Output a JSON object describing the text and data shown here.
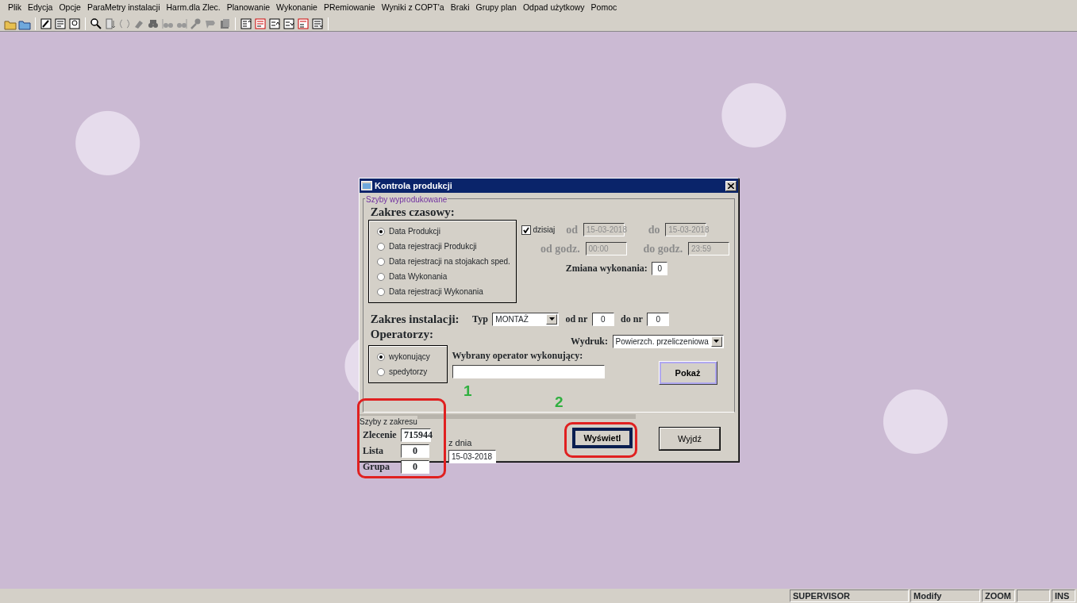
{
  "menu": [
    "Plik",
    "Edycja",
    "Opcje",
    "ParaMetry instalacji",
    "Harm.dla Zlec.",
    "Planowanie",
    "Wykonanie",
    "PRemiowanie",
    "Wyniki z COPT'a",
    "Braki",
    "Grupy plan",
    "Odpad użytkowy",
    "Pomoc"
  ],
  "dialog": {
    "title": "Kontrola produkcji",
    "group_label": "Szyby wyprodukowane",
    "time_range": {
      "heading": "Zakres czasowy:",
      "options": [
        {
          "label": "Data Produkcji",
          "selected": true
        },
        {
          "label": "Data rejestracji Produkcji",
          "selected": false
        },
        {
          "label": "Data rejestracji na stojakach sped.",
          "selected": false
        },
        {
          "label": "Data Wykonania",
          "selected": false
        },
        {
          "label": "Data rejestracji Wykonania",
          "selected": false
        }
      ]
    },
    "today": {
      "label": "dzisiaj",
      "checked": true
    },
    "dates": [
      {
        "label": "od",
        "value": "15-03-2018",
        "disabled": true
      },
      {
        "label": "do",
        "value": "15-03-2018",
        "disabled": true
      }
    ],
    "times": [
      {
        "label": "od godz.",
        "value": "00:00",
        "disabled": true
      },
      {
        "label": "do godz.",
        "value": "23:59",
        "disabled": true
      }
    ],
    "shift": {
      "label": "Zmiana wykonania:",
      "value": "0"
    },
    "installation": {
      "heading": "Zakres instalacji:",
      "type_label": "Typ",
      "type_value": "MONTAŻ",
      "from_label": "od nr",
      "from_value": "0",
      "to_label": "do nr",
      "to_value": "0"
    },
    "operators": {
      "heading": "Operatorzy:",
      "options": [
        {
          "label": "wykonujący",
          "selected": true
        },
        {
          "label": "spedytorzy",
          "selected": false
        }
      ]
    },
    "printout": {
      "label": "Wydruk:",
      "value": "Powierzch. przeliczeniowa"
    },
    "selected_operator": {
      "label": "Wybrany operator wykonujący:"
    },
    "show_button": "Pokaż",
    "range": {
      "group_label": "Szyby z zakresu",
      "fields": [
        {
          "label": "Zlecenie",
          "value": "715944"
        },
        {
          "label": "Lista",
          "value": "0"
        },
        {
          "label": "Grupa",
          "value": "0"
        }
      ],
      "date_label": "z dnia",
      "date_value": "15-03-2018"
    },
    "display_button": "Wyświetl",
    "exit_button": "Wyjdź"
  },
  "annotations": [
    {
      "label": "1"
    },
    {
      "label": "2"
    }
  ],
  "status_bar": {
    "user": "SUPERVISOR",
    "mode": "Modify",
    "zoom": "ZOOM",
    "insert": "INS"
  }
}
